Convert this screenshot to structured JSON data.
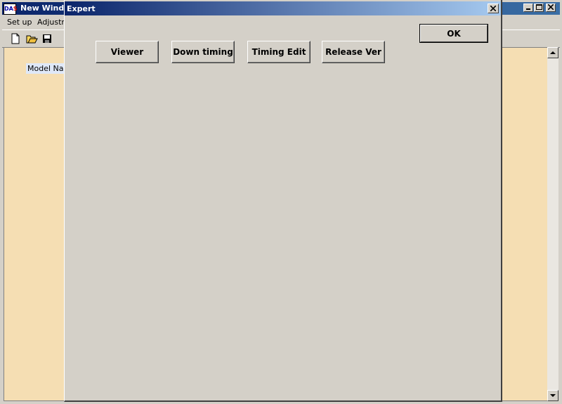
{
  "main_window": {
    "icon_text": [
      "DA",
      "S"
    ],
    "title": "New Windo",
    "menu": [
      "Set up",
      "Adjustm"
    ],
    "toolbar_icons": [
      "new-file-icon",
      "open-folder-icon",
      "save-disk-icon"
    ],
    "model_name_label": "Model Nam"
  },
  "dialog": {
    "title": "Expert",
    "ok_label": "OK",
    "buttons": [
      "Viewer",
      "Down timing",
      "Timing Edit",
      "Release Ver"
    ]
  },
  "colors": {
    "client_bg": "#f5deb3",
    "face": "#d4d0c8",
    "title_active": "#0a246a"
  }
}
